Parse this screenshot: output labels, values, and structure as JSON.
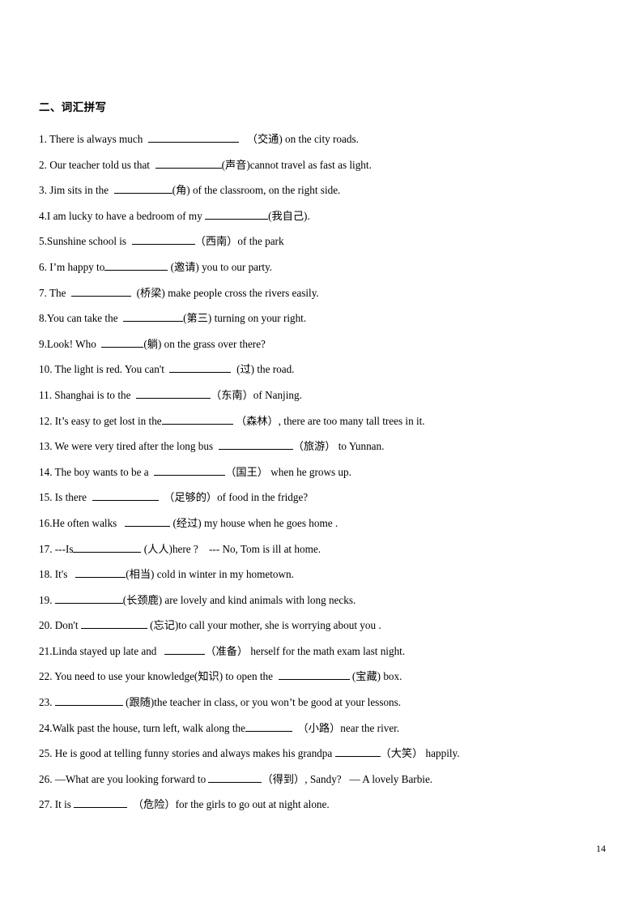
{
  "document": {
    "page_number": "14",
    "heading": "二、词汇拼写"
  },
  "questions": [
    {
      "number": "1.",
      "pre": "1. There is always much  ",
      "blank_width": 112,
      "post": "   （交通) on the city roads.",
      "hint": "交通"
    },
    {
      "number": "2.",
      "pre": "2. Our teacher told us that  ",
      "blank_width": 82,
      "post": "(声音)cannot travel as fast as light.",
      "hint": "声音"
    },
    {
      "number": "3.",
      "pre": "3. Jim sits in the  ",
      "blank_width": 72,
      "post": "(角) of the classroom, on the right side.",
      "hint": "角"
    },
    {
      "number": "4.",
      "pre": "4.I am lucky to have a bedroom of my ",
      "blank_width": 78,
      "post": "(我自己).",
      "hint": "我自己"
    },
    {
      "number": "5.",
      "pre": "5.Sunshine school is  ",
      "blank_width": 78,
      "post": "（西南）of the park",
      "hint": "西南"
    },
    {
      "number": "6.",
      "pre": "6. I’m happy to",
      "blank_width": 78,
      "post": " (邀请) you to our party.",
      "hint": "邀请"
    },
    {
      "number": "7.",
      "pre": "7. The  ",
      "blank_width": 74,
      "post": "  (桥梁) make people cross the rivers easily.",
      "hint": "桥梁"
    },
    {
      "number": "8.",
      "pre": "8.You can take the  ",
      "blank_width": 74,
      "post": "(第三) turning on your right.",
      "hint": "第三"
    },
    {
      "number": "9.",
      "pre": "9.Look! Who  ",
      "blank_width": 52,
      "post": "(躺) on the grass over there?",
      "hint": "躺"
    },
    {
      "number": "10.",
      "pre": "10. The light is red. You can't  ",
      "blank_width": 76,
      "post": "  (过) the road.",
      "hint": "过"
    },
    {
      "number": "11.",
      "pre": "11. Shanghai is to the  ",
      "blank_width": 92,
      "post": "（东南）of Nanjing.",
      "hint": "东南"
    },
    {
      "number": "12.",
      "pre": "12. It’s easy to get lost in the",
      "blank_width": 88,
      "post": " （森林）, there are too many tall trees in it.",
      "hint": "森林"
    },
    {
      "number": "13.",
      "pre": "13. We were very tired after the long bus  ",
      "blank_width": 92,
      "post": "（旅游） to Yunnan.",
      "hint": "旅游"
    },
    {
      "number": "14.",
      "pre": "14. The boy wants to be a  ",
      "blank_width": 88,
      "post": "（国王） when he grows up.",
      "hint": "国王"
    },
    {
      "number": "15.",
      "pre": "15. Is there  ",
      "blank_width": 82,
      "post": "  （足够的）of food in the fridge?",
      "hint": "足够的"
    },
    {
      "number": "16.",
      "pre": "16.He often walks   ",
      "blank_width": 56,
      "post": " (经过) my house when he goes home .",
      "hint": "经过"
    },
    {
      "number": "17.",
      "pre": "17. ---Is",
      "blank_width": 84,
      "post": " (人人)here ?    --- No, Tom is ill at home.",
      "hint": "人人"
    },
    {
      "number": "18.",
      "pre": "18. It's   ",
      "blank_width": 62,
      "post": "(相当) cold in winter in my hometown.",
      "hint": "相当"
    },
    {
      "number": "19.",
      "pre": "19. ",
      "blank_width": 84,
      "post": "(长颈鹿) are lovely and kind animals with long necks.",
      "hint": "长颈鹿"
    },
    {
      "number": "20.",
      "pre": "20. Don't ",
      "blank_width": 82,
      "post": " (忘记)to call your mother, she is worrying about you .",
      "hint": "忘记"
    },
    {
      "number": "21.",
      "pre": "21.Linda stayed up late and   ",
      "blank_width": 50,
      "post": "（准备） herself for the math exam last night.",
      "hint": "准备"
    },
    {
      "number": "22.",
      "pre": "22. You need to use your knowledge(知识) to open the  ",
      "blank_width": 88,
      "post": " (宝藏) box.",
      "hint": "宝藏"
    },
    {
      "number": "23.",
      "pre": "23. ",
      "blank_width": 84,
      "post": " (跟随)the teacher in class, or you won’t be good at your lessons.",
      "hint": "跟随"
    },
    {
      "number": "24.",
      "pre": "24.Walk past the house, turn left, walk along the",
      "blank_width": 58,
      "post": "  （小路）near the river.",
      "hint": "小路"
    },
    {
      "number": "25.",
      "pre": "25. He is good at telling funny stories and always makes his grandpa ",
      "blank_width": 56,
      "post": "（大笑） happily.",
      "hint": "大笑"
    },
    {
      "number": "26.",
      "pre": "26. —What are you looking forward to ",
      "blank_width": 66,
      "post": "（得到）, Sandy?   — A lovely Barbie.",
      "hint": "得到"
    },
    {
      "number": "27.",
      "pre": "27. It is ",
      "blank_width": 66,
      "post": "  （危险）for the girls to go out at night alone.",
      "hint": "危险"
    }
  ]
}
